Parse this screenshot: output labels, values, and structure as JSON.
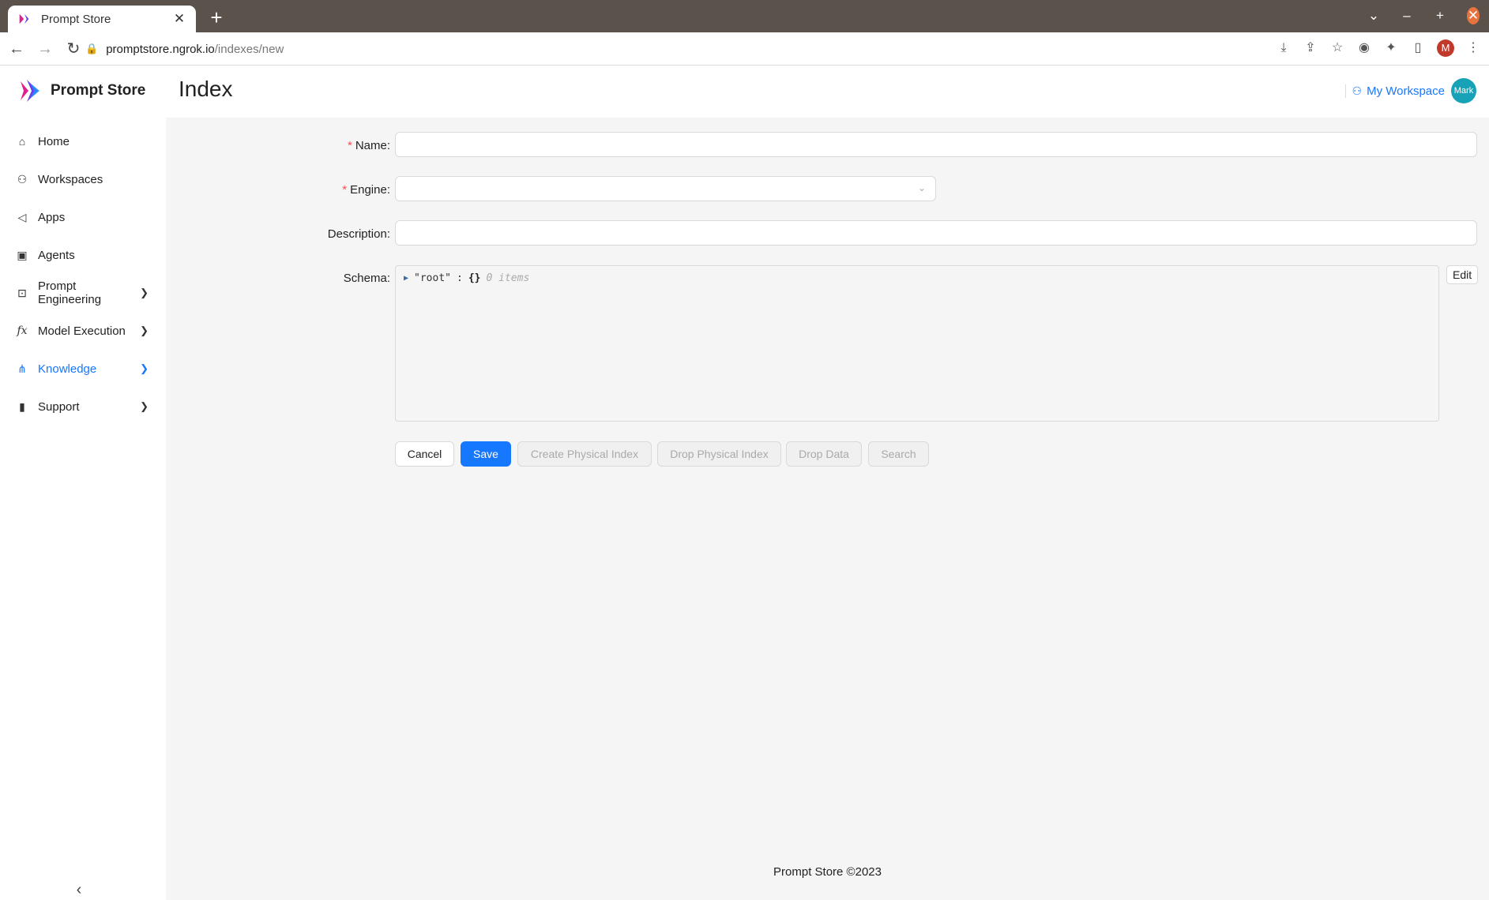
{
  "browser": {
    "tab_title": "Prompt Store",
    "url_host": "promptstore.ngrok.io",
    "url_path": "/indexes/new",
    "profile_initial": "M"
  },
  "app": {
    "brand": "Prompt Store",
    "page_title": "Index",
    "workspace_label": "My Workspace",
    "avatar_text": "Mark",
    "footer": "Prompt Store ©2023"
  },
  "sidebar": {
    "items": [
      {
        "label": "Home",
        "icon": "home-icon"
      },
      {
        "label": "Workspaces",
        "icon": "users-icon"
      },
      {
        "label": "Apps",
        "icon": "megaphone-icon"
      },
      {
        "label": "Agents",
        "icon": "robot-icon"
      },
      {
        "label": "Prompt Engineering",
        "icon": "terminal-icon"
      },
      {
        "label": "Model Execution",
        "icon": "function-icon"
      },
      {
        "label": "Knowledge",
        "icon": "nodes-icon"
      },
      {
        "label": "Support",
        "icon": "book-icon"
      }
    ]
  },
  "form": {
    "name_label": "Name",
    "engine_label": "Engine",
    "description_label": "Description",
    "schema_label": "Schema",
    "name_value": "",
    "engine_value": "",
    "description_value": "",
    "schema": {
      "key": "\"root\"",
      "colon": ":",
      "brace": "{}",
      "count": "0 items"
    },
    "edit_label": "Edit"
  },
  "actions": {
    "cancel": "Cancel",
    "save": "Save",
    "create_physical_index": "Create Physical Index",
    "drop_physical_index": "Drop Physical Index",
    "drop_data": "Drop Data",
    "search": "Search"
  },
  "colors": {
    "accent": "#1677ff",
    "required": "#ff4d4f",
    "avatar": "#17a2b8"
  }
}
